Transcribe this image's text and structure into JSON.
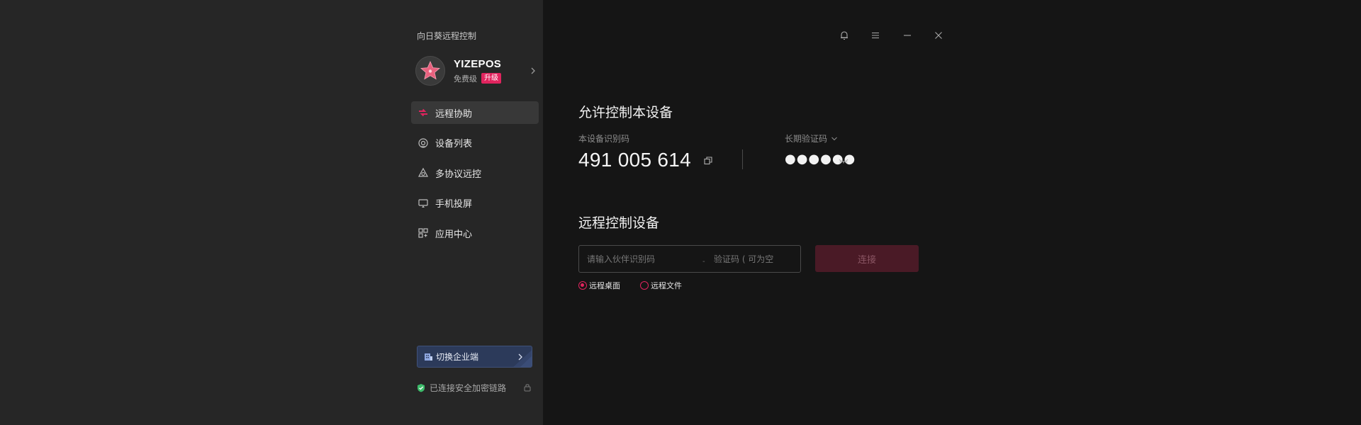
{
  "app": {
    "title": "向日葵远程控制"
  },
  "profile": {
    "username": "YIZEPOS",
    "tier": "免费级",
    "upgrade": "升级"
  },
  "nav": {
    "items": [
      {
        "label": "远程协助",
        "icon": "remote-assist-icon",
        "active": true
      },
      {
        "label": "设备列表",
        "icon": "device-list-icon",
        "active": false
      },
      {
        "label": "多协议远控",
        "icon": "multi-protocol-icon",
        "active": false
      },
      {
        "label": "手机投屏",
        "icon": "screen-cast-icon",
        "active": false
      },
      {
        "label": "应用中心",
        "icon": "app-center-icon",
        "active": false
      }
    ]
  },
  "footer": {
    "enterprise_switch": "切换企业端",
    "secure_status": "已连接安全加密链路"
  },
  "allow_control": {
    "title": "允许控制本设备",
    "device_id_label": "本设备识别码",
    "device_id": "491 005 614",
    "password_label": "长期验证码",
    "password_masked": "●●●●●●"
  },
  "remote_control": {
    "title": "远程控制设备",
    "partner_id_placeholder": "请输入伙伴识别码",
    "separator": "-",
    "verify_placeholder": "验证码 ( 可为空",
    "connect": "连接",
    "modes": [
      {
        "label": "远程桌面",
        "checked": true
      },
      {
        "label": "远程文件",
        "checked": false
      }
    ]
  },
  "colors": {
    "accent": "#e0245e",
    "sidebar_bg": "#262626",
    "main_bg": "#151515",
    "enterprise_bg": "#2c3a5a"
  }
}
